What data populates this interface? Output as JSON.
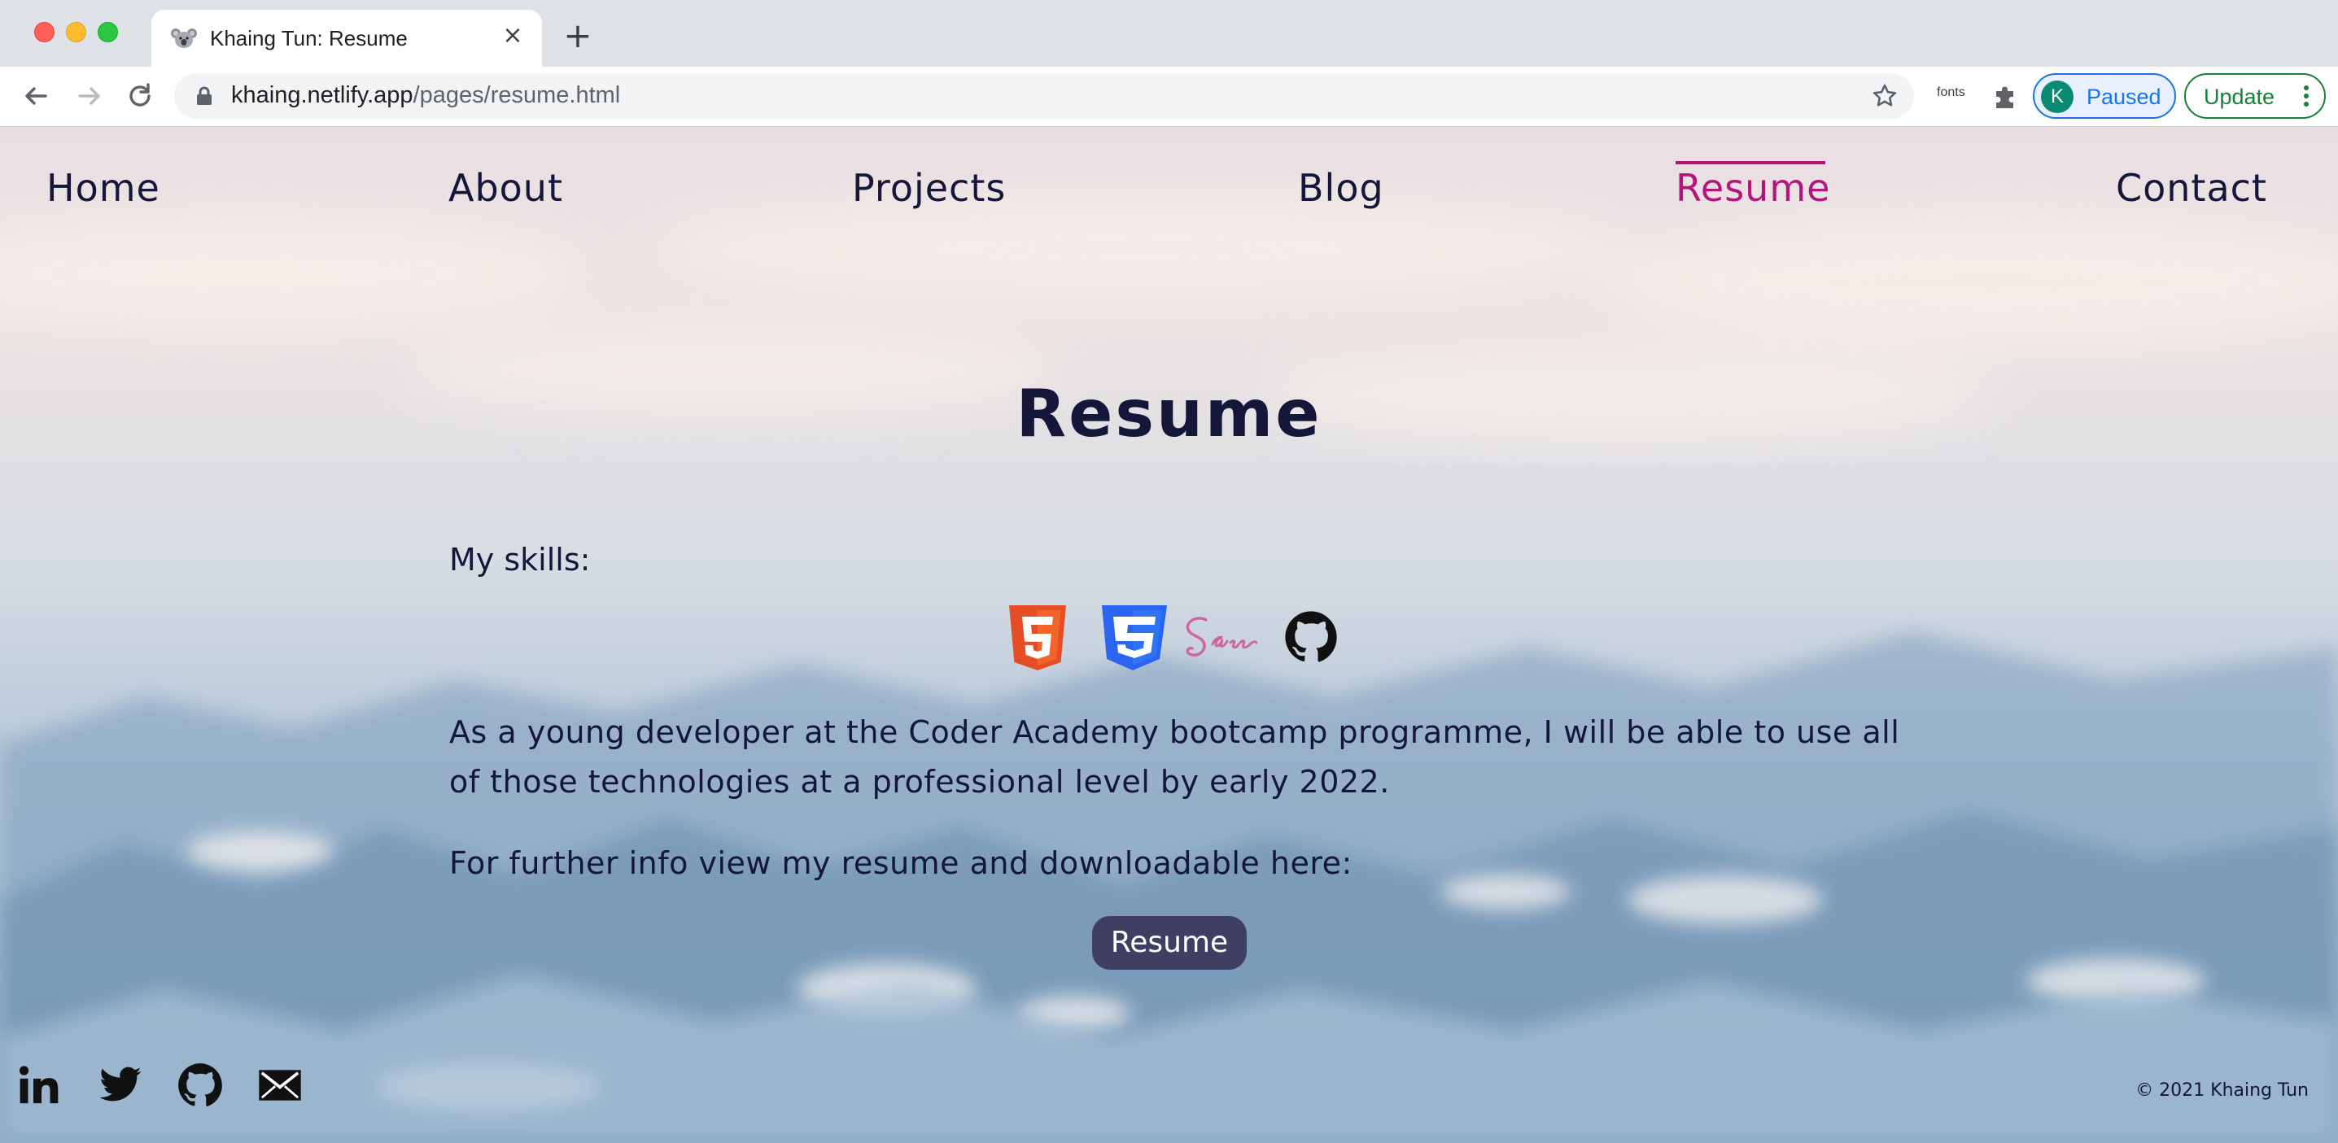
{
  "browser": {
    "tab_title": "Khaing Tun: Resume",
    "tab_close": "×",
    "new_tab": "+",
    "url_host": "khaing.netlify.app",
    "url_path": "/pages/resume.html",
    "extension_fonts": "fonts",
    "profile_initial": "K",
    "profile_status": "Paused",
    "update_label": "Update",
    "icons": [
      "koala-favicon-icon",
      "back-arrow-icon",
      "forward-arrow-icon",
      "reload-icon",
      "lock-icon",
      "bookmark-star-icon",
      "extensions-puzzle-icon",
      "kebab-menu-icon"
    ]
  },
  "nav": {
    "items": [
      {
        "label": "Home"
      },
      {
        "label": "About"
      },
      {
        "label": "Projects"
      },
      {
        "label": "Blog"
      },
      {
        "label": "Resume",
        "active": true
      },
      {
        "label": "Contact"
      }
    ],
    "text_color": "#14163a",
    "active_color": "#b4157b"
  },
  "main": {
    "title": "Resume",
    "skills_label": "My skills:",
    "skills": [
      "html5-icon",
      "css3-icon",
      "sass-icon",
      "github-icon"
    ],
    "paragraph1": "As a young developer at the Coder Academy bootcamp programme, I will be able to use all of those technologies at a professional level by early 2022.",
    "paragraph2": "For further info view my resume and downloadable here:",
    "resume_button": "Resume",
    "button_color": "#3e3f62"
  },
  "footer": {
    "social": [
      "linkedin-icon",
      "twitter-icon",
      "github-icon",
      "email-icon"
    ],
    "copyright": "© 2021 Khaing Tun"
  }
}
